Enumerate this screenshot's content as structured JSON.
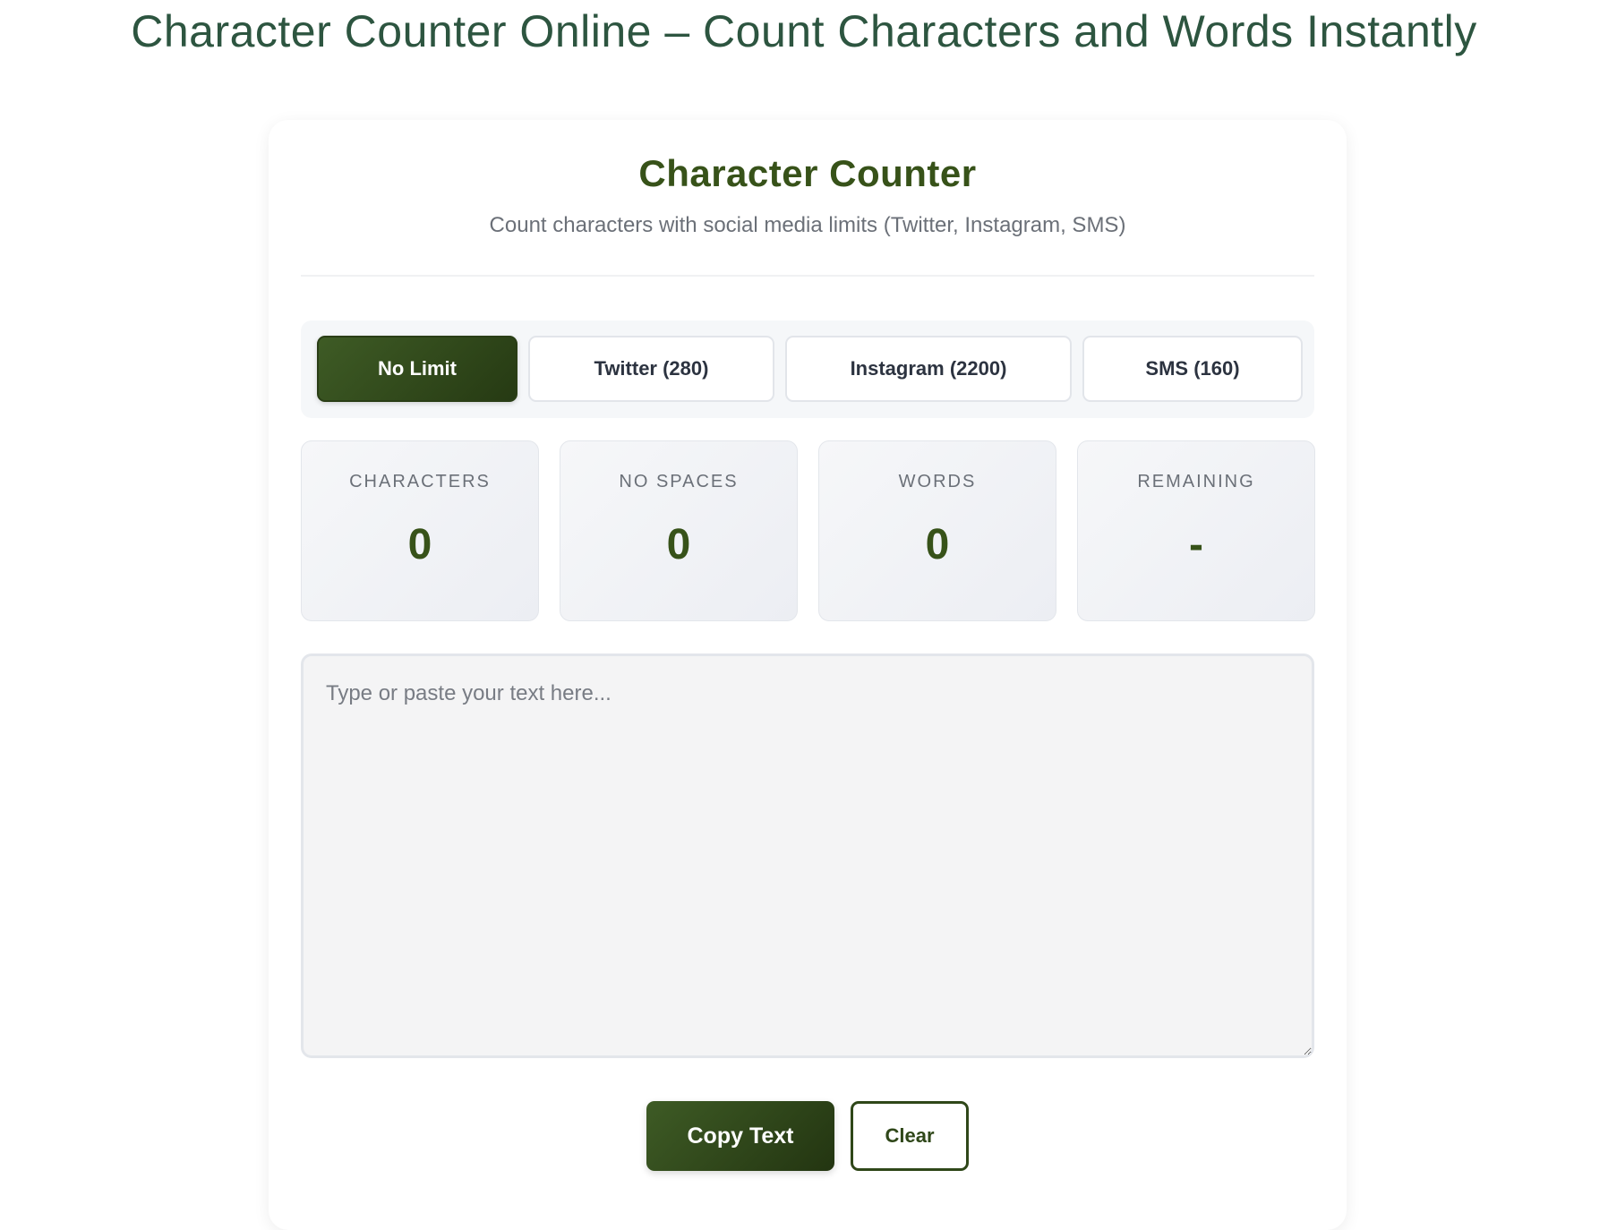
{
  "page": {
    "title": "Character Counter Online – Count Characters and Words Instantly"
  },
  "tool": {
    "title": "Character Counter",
    "subtitle": "Count characters with social media limits (Twitter, Instagram, SMS)"
  },
  "limits": {
    "selected": "No Limit",
    "options": [
      {
        "label": "No Limit",
        "active": true
      },
      {
        "label": "Twitter (280)",
        "active": false
      },
      {
        "label": "Instagram (2200)",
        "active": false
      },
      {
        "label": "SMS (160)",
        "active": false
      }
    ]
  },
  "stats": [
    {
      "label": "CHARACTERS",
      "value": "0"
    },
    {
      "label": "NO SPACES",
      "value": "0"
    },
    {
      "label": "WORDS",
      "value": "0"
    },
    {
      "label": "REMAINING",
      "value": "-"
    }
  ],
  "editor": {
    "value": "",
    "placeholder": "Type or paste your text here..."
  },
  "actions": {
    "copy_label": "Copy Text",
    "clear_label": "Clear"
  },
  "colors": {
    "accent": "#375219",
    "heading": "#2d5540",
    "muted": "#6b7078"
  }
}
